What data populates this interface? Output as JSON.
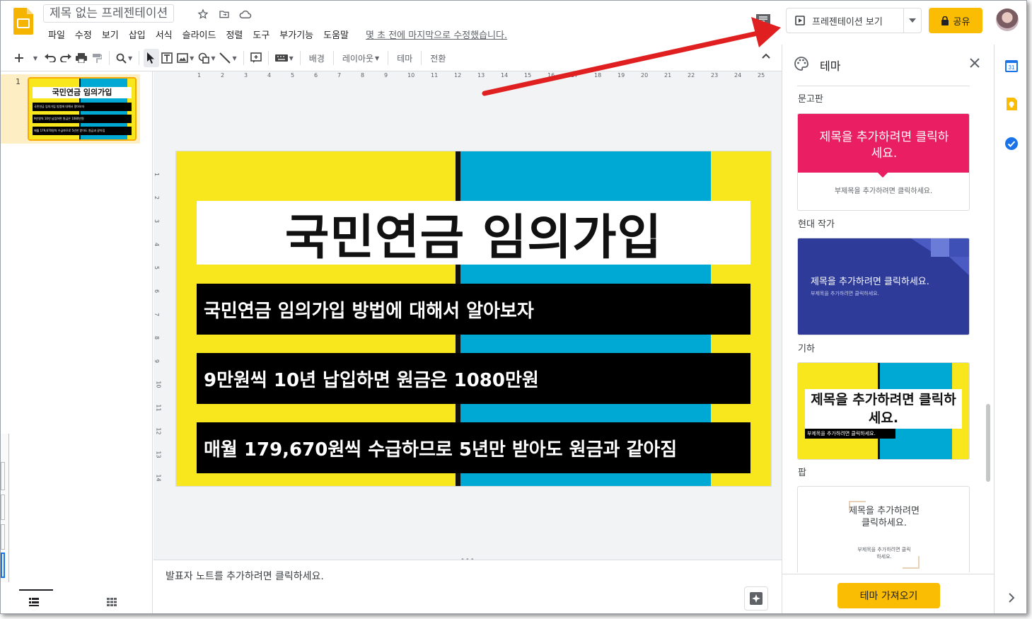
{
  "app": {
    "doc_title": "제목 없는 프레젠테이션",
    "menu": [
      "파일",
      "수정",
      "보기",
      "삽입",
      "서식",
      "슬라이드",
      "정렬",
      "도구",
      "부가기능",
      "도움말"
    ],
    "last_edit": "몇 초 전에 마지막으로 수정했습니다.",
    "present_label": "프레젠테이션 보기",
    "share_label": "공유"
  },
  "toolbar": {
    "background_label": "배경",
    "layout_label": "레이아웃",
    "theme_label": "테마",
    "transition_label": "전환"
  },
  "filmstrip": {
    "slide_number": "1",
    "thumb_title": "국민연금 임의가입",
    "thumb_lines": [
      "국민연금 임의가입 방법에 대해서 알아보자",
      "9만원씩 10년 납입하면 원금은 1080만원",
      "매월 179,670원씩 수급하므로 5년만 받아도 원금과 같아짐"
    ]
  },
  "slide": {
    "title": "국민연금 임의가입",
    "lines": [
      "국민연금 임의가입 방법에 대해서 알아보자",
      "9만원씩 10년 납입하면 원금은 1080만원",
      "매월 179,670원씩 수급하므로 5년만 받아도 원금과 같아짐"
    ],
    "colors": {
      "yellow": "#f8e71c",
      "blue": "#00a8d4",
      "black": "#000000"
    }
  },
  "ruler": {
    "top_ticks": [
      "1",
      "2",
      "3",
      "4",
      "5",
      "6",
      "7",
      "8",
      "9",
      "10",
      "11",
      "12",
      "13",
      "14",
      "15",
      "16",
      "17",
      "18",
      "19",
      "20",
      "21",
      "22",
      "23",
      "24",
      "25"
    ],
    "left_ticks": [
      "1",
      "2",
      "3",
      "4",
      "5",
      "6",
      "7",
      "8",
      "9",
      "10",
      "11",
      "12",
      "13",
      "14"
    ]
  },
  "notes": {
    "placeholder": "발표자 노트를 추가하려면 클릭하세요."
  },
  "theme_panel": {
    "title": "테마",
    "import_label": "테마 가져오기",
    "themes": [
      {
        "name": "문고판",
        "title_text": "제목을 추가하려면 클릭하세요.",
        "subtitle_text": "부제목을 추가하려면 클릭하세요."
      },
      {
        "name": "현대 작가",
        "title_text": "제목을 추가하려면 클릭하세요.",
        "subtitle_text": "부제목을 추가하려면 클릭하세요."
      },
      {
        "name": "기하",
        "title_text": "제목을 추가하려면 클릭하세요.",
        "subtitle_text": "부제목을 추가하려면 클릭하세요."
      },
      {
        "name": "팝",
        "title_text": "제목을 추가하려면 클릭하세요.",
        "subtitle_text": "부제목을 추가하려면 클릭하세요."
      }
    ]
  }
}
